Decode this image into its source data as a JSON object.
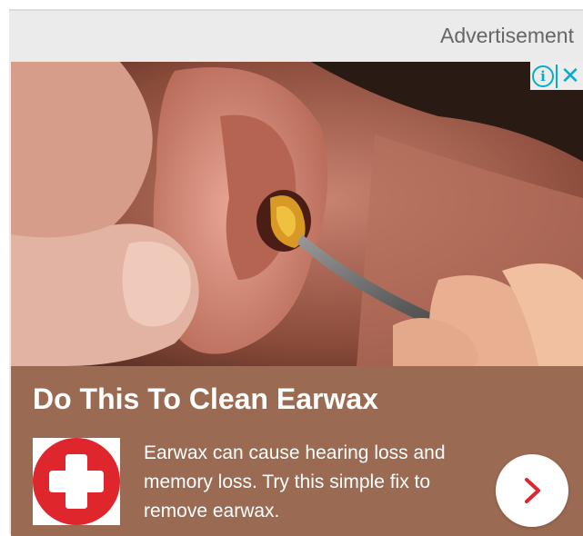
{
  "ad": {
    "label": "Advertisement",
    "headline": "Do This To Clean Earwax",
    "body": "Earwax can cause hearing loss and memory loss. Try this simple fix to remove earwax.",
    "adchoices": {
      "info_icon": "info-icon",
      "close_icon": "close-icon",
      "color": "#00aecd"
    },
    "cta_icon": "chevron-right-icon",
    "logo_icon": "medical-cross-icon",
    "colors": {
      "panel": "#9a6a52",
      "accent_red": "#e0262d",
      "frame": "#ebebeb"
    }
  }
}
